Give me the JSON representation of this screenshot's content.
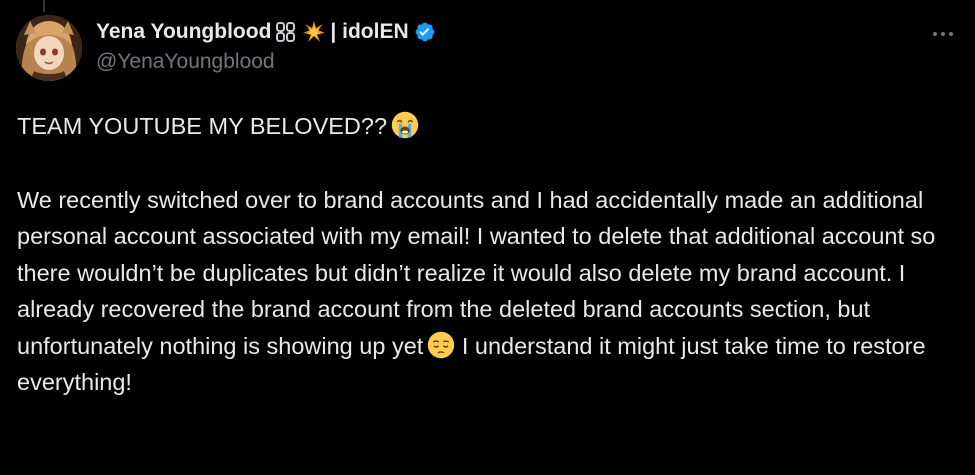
{
  "author": {
    "display_name": "Yena Youngblood",
    "name_emojis": "⛓💥",
    "name_suffix": "| idolEN",
    "handle": "@YenaYoungblood",
    "verified": true,
    "avatar": "avatar-image"
  },
  "icons": {
    "verified": "verified-badge-icon",
    "more": "more-options-icon",
    "thread_line": "thread-connector"
  },
  "tweet": {
    "heading": "TEAM YOUTUBE MY BELOVED??",
    "heading_emoji": "loudly-crying-face",
    "paragraph_part1": "We recently switched over to brand accounts and I had accidentally made an additional personal account associated with my email! I wanted to delete that additional account so there wouldn’t be duplicates but didn’t realize it would also delete my brand account. I already recovered the brand account from the deleted brand accounts section, but unfortunately nothing is showing up yet",
    "paragraph_emoji": "pensive-face",
    "paragraph_part2": "I understand it might just take time to restore everything!"
  },
  "colors": {
    "background": "#000000",
    "text": "#e7e9ea",
    "muted": "#71767b",
    "verified_blue": "#1d9bf0"
  }
}
